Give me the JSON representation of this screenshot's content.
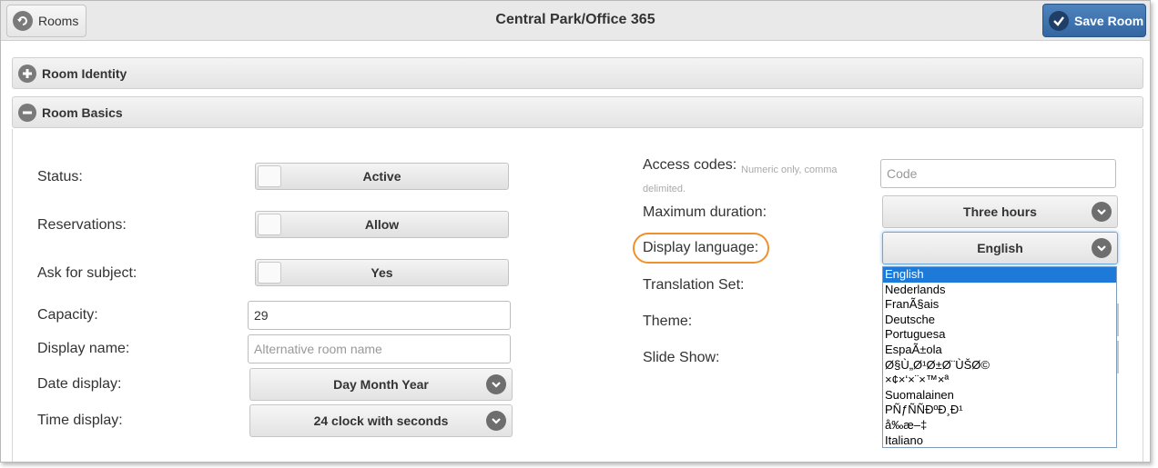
{
  "header": {
    "back_label": "Rooms",
    "title": "Central Park/Office 365",
    "save_label": "Save Room"
  },
  "sections": {
    "identity": "Room Identity",
    "basics": "Room Basics"
  },
  "left": {
    "status": {
      "label": "Status:",
      "value": "Active"
    },
    "reservations": {
      "label": "Reservations:",
      "value": "Allow"
    },
    "ask_subject": {
      "label": "Ask for subject:",
      "value": "Yes"
    },
    "capacity": {
      "label": "Capacity:",
      "value": "29"
    },
    "display_name": {
      "label": "Display name:",
      "placeholder": "Alternative room name"
    },
    "date_display": {
      "label": "Date display:",
      "value": "Day Month Year"
    },
    "time_display": {
      "label": "Time display:",
      "value": "24 clock with seconds"
    }
  },
  "right": {
    "access_codes": {
      "label": "Access codes:",
      "hint": "Numeric only, comma delimited.",
      "placeholder": "Code"
    },
    "max_duration": {
      "label": "Maximum duration:",
      "value": "Three hours"
    },
    "display_language": {
      "label": "Display language:",
      "value": "English"
    },
    "translation_set": {
      "label": "Translation Set:"
    },
    "theme": {
      "label": "Theme:"
    },
    "slide_show": {
      "label": "Slide Show:"
    }
  },
  "language_options": [
    "English",
    "Nederlands",
    "FranÃ§ais",
    "Deutsche",
    "Portuguesa",
    "EspaÃ±ola",
    "Ø§Ù„Ø¹Ø±Ø¨ÙŠØ©",
    "×¢×‘×¨×™×ª",
    "Suomalainen",
    "PÑƒÑÑÐºÐ¸Ð¹",
    "å‰æ–‡",
    "Italiano"
  ],
  "selected_language_index": 0,
  "colors": {
    "accent": "#3a6ea8",
    "highlight_ring": "#f0902c",
    "selected_option": "#1e7ad9"
  }
}
